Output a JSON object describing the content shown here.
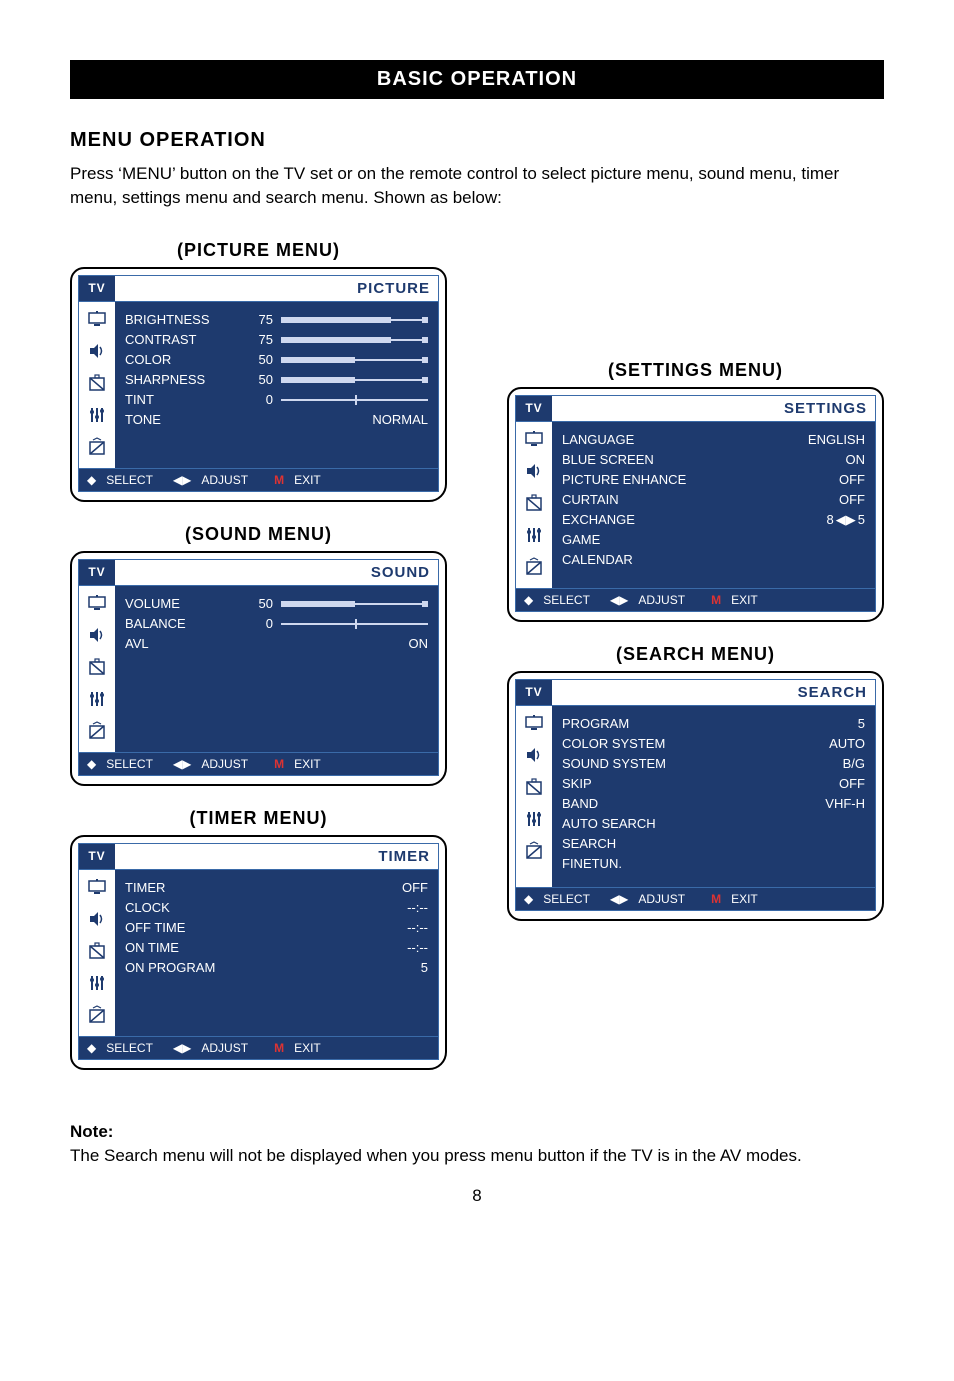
{
  "header": {
    "title": "BASIC OPERATION"
  },
  "section_title": "MENU OPERATION",
  "intro": "Press ‘MENU’ button on the TV set or on the remote control to select picture menu, sound menu, timer menu, settings menu and search menu. Shown as below:",
  "captions": {
    "picture": "(PICTURE MENU)",
    "sound": "(SOUND MENU)",
    "timer": "(TIMER MENU)",
    "settings": "(SETTINGS MENU)",
    "search": "(SEARCH MENU)"
  },
  "osd_common": {
    "tv": "TV",
    "footer_select": "SELECT",
    "footer_adjust": "ADJUST",
    "footer_exit_prefix": "M",
    "footer_exit": "EXIT"
  },
  "picture": {
    "title": "PICTURE",
    "rows": {
      "brightness": {
        "label": "BRIGHTNESS",
        "value": "75",
        "pct": 75
      },
      "contrast": {
        "label": "CONTRAST",
        "value": "75",
        "pct": 75
      },
      "color": {
        "label": "COLOR",
        "value": "50",
        "pct": 50
      },
      "sharpness": {
        "label": "SHARPNESS",
        "value": "50",
        "pct": 50
      },
      "tint": {
        "label": "TINT",
        "value": "0",
        "pct": 50,
        "center": true
      },
      "tone": {
        "label": "TONE",
        "right": "NORMAL"
      }
    }
  },
  "sound": {
    "title": "SOUND",
    "rows": {
      "volume": {
        "label": "VOLUME",
        "value": "50",
        "pct": 50
      },
      "balance": {
        "label": "BALANCE",
        "value": "0",
        "pct": 50,
        "center": true
      },
      "avl": {
        "label": "AVL",
        "right": "ON"
      }
    }
  },
  "timer": {
    "title": "TIMER",
    "rows": {
      "timer": {
        "label": "TIMER",
        "right": "OFF"
      },
      "clock": {
        "label": "CLOCK",
        "right": "--:--"
      },
      "off_time": {
        "label": "OFF TIME",
        "right": "--:--"
      },
      "on_time": {
        "label": "ON TIME",
        "right": "--:--"
      },
      "on_program": {
        "label": "ON PROGRAM",
        "right": "5"
      }
    }
  },
  "settings": {
    "title": "SETTINGS",
    "rows": {
      "language": {
        "label": "LANGUAGE",
        "right": "ENGLISH"
      },
      "blue_screen": {
        "label": "BLUE SCREEN",
        "right": "ON"
      },
      "picture_enhance": {
        "label": "PICTURE ENHANCE",
        "right": "OFF"
      },
      "curtain": {
        "label": "CURTAIN",
        "right": "OFF"
      },
      "exchange": {
        "label": "EXCHANGE",
        "right_a": "8",
        "right_b": "5"
      },
      "game": {
        "label": "GAME"
      },
      "calendar": {
        "label": "CALENDAR"
      }
    }
  },
  "search": {
    "title": "SEARCH",
    "rows": {
      "program": {
        "label": "PROGRAM",
        "right": "5"
      },
      "color_system": {
        "label": "COLOR SYSTEM",
        "right": "AUTO"
      },
      "sound_system": {
        "label": "SOUND SYSTEM",
        "right": "B/G"
      },
      "skip": {
        "label": "SKIP",
        "right": "OFF"
      },
      "band": {
        "label": "BAND",
        "right": "VHF-H"
      },
      "auto_search": {
        "label": "AUTO SEARCH"
      },
      "search_item": {
        "label": "SEARCH"
      },
      "finetun": {
        "label": "FINETUN."
      }
    }
  },
  "note": {
    "title": "Note:",
    "body": "The Search menu will not be displayed when you press menu button if the TV is in the AV modes."
  },
  "page_number": "8"
}
